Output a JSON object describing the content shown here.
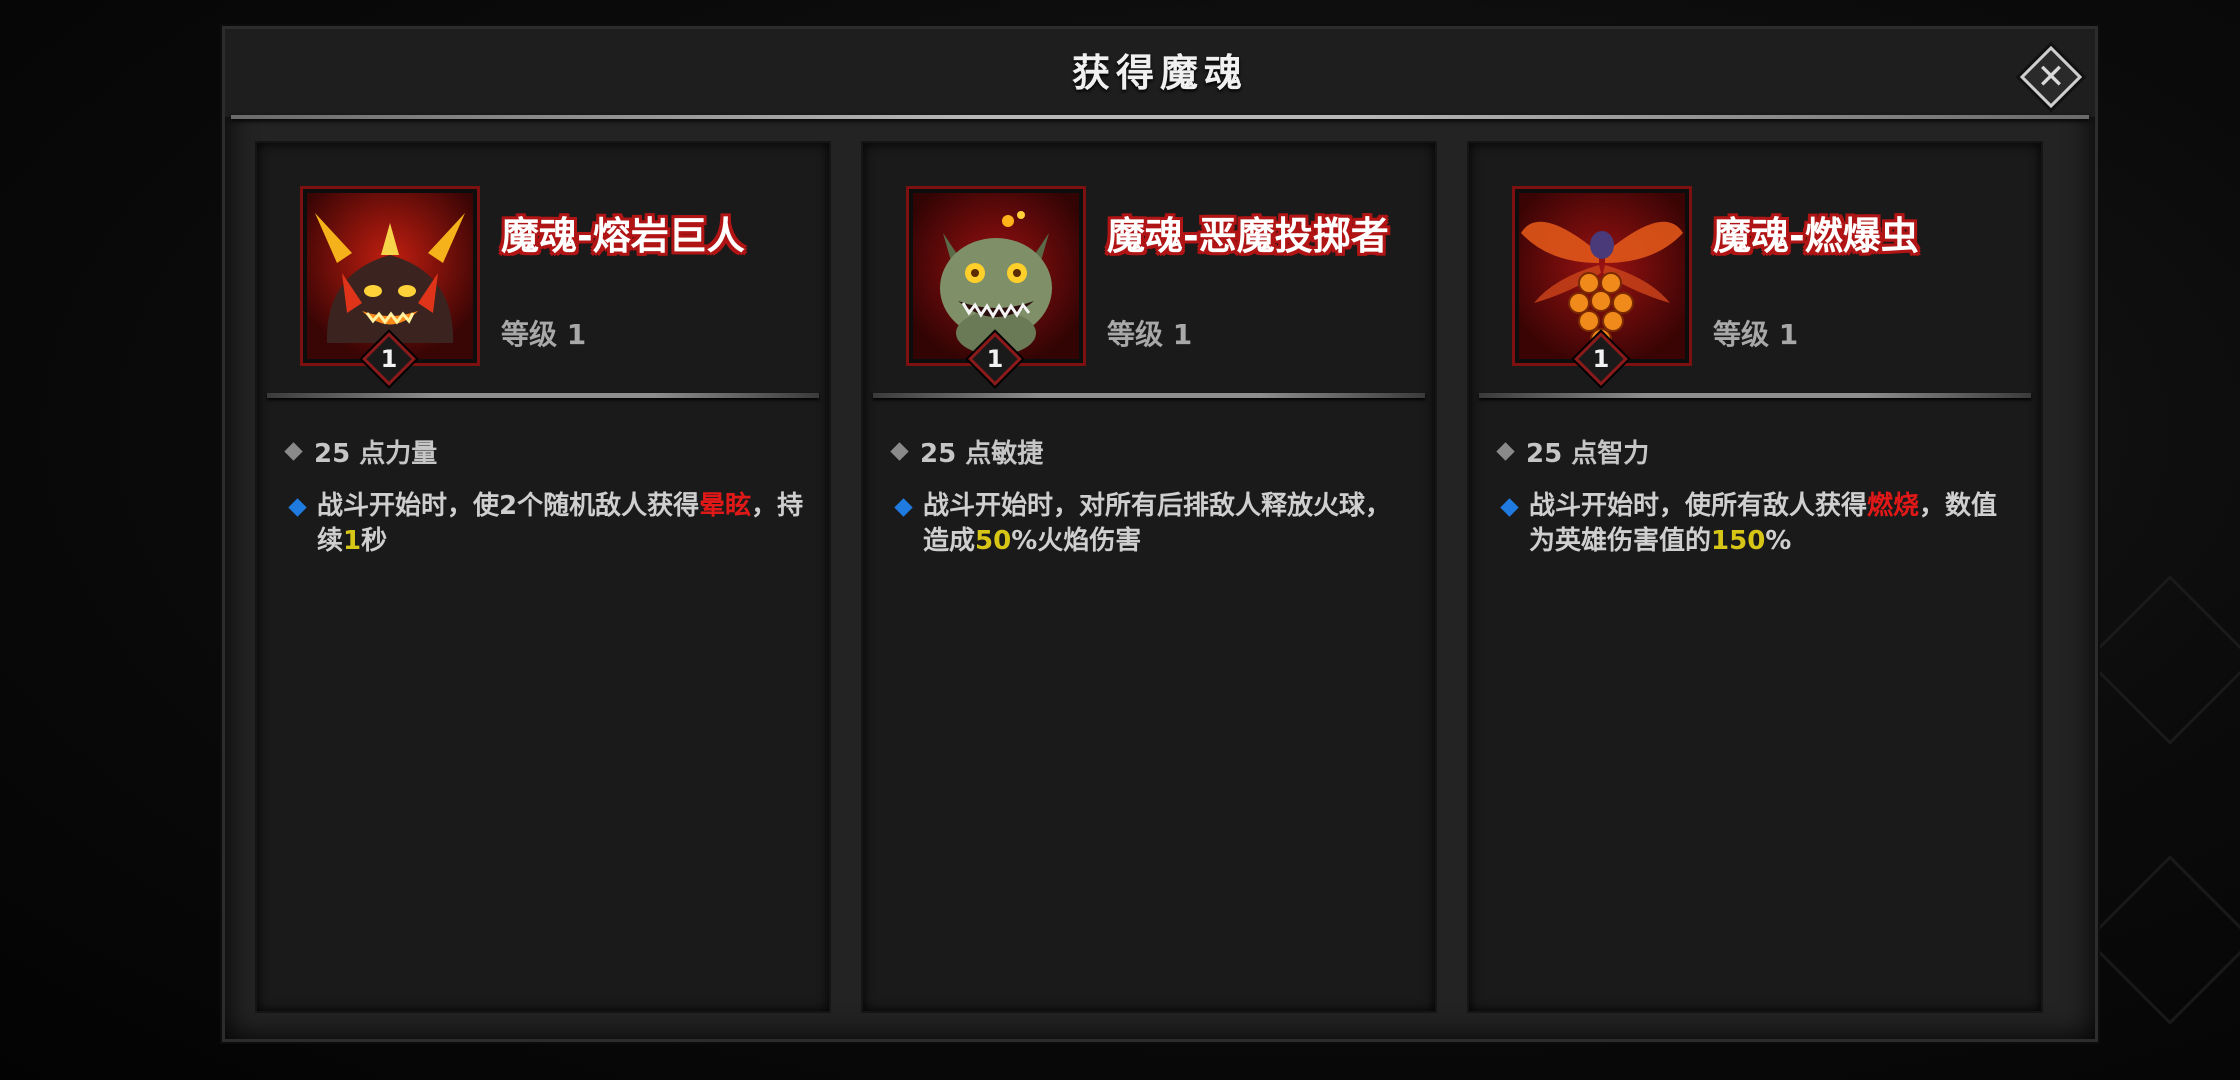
{
  "dialog": {
    "title": "获得魔魂",
    "close_icon": "close-icon"
  },
  "cards": [
    {
      "name": "魔魂-熔岩巨人",
      "level_text": "等级 1",
      "level_badge": "1",
      "portrait": "lava-giant-portrait",
      "stat": "25 点力量",
      "effect_parts": [
        "战斗开始时，使2个随机敌人获得",
        "晕眩",
        "，持续",
        "1",
        "秒"
      ]
    },
    {
      "name": "魔魂-恶魔投掷者",
      "level_text": "等级 1",
      "level_badge": "1",
      "portrait": "demon-thrower-portrait",
      "stat": "25 点敏捷",
      "effect_parts": [
        "战斗开始时，对所有后排敌人释放火球，造成",
        "50",
        "%火焰伤害"
      ]
    },
    {
      "name": "魔魂-燃爆虫",
      "level_text": "等级 1",
      "level_badge": "1",
      "portrait": "burst-bug-portrait",
      "stat": "25 点智力",
      "effect_parts": [
        "战斗开始时，使所有敌人获得",
        "燃烧",
        "，数值为英雄伤害值的",
        "150",
        "%"
      ]
    }
  ],
  "colors": {
    "highlight_red": "#e01818",
    "highlight_yellow": "#d8c617",
    "bullet_blue": "#1f7be0"
  }
}
